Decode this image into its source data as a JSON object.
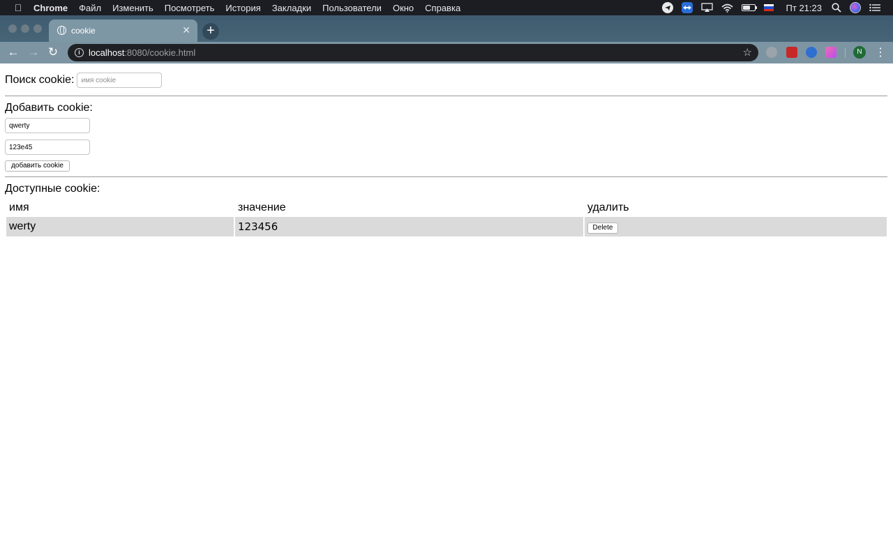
{
  "menubar": {
    "app": "Chrome",
    "items": [
      "Файл",
      "Изменить",
      "Посмотреть",
      "История",
      "Закладки",
      "Пользователи",
      "Окно",
      "Справка"
    ],
    "clock": "Пт 21:23",
    "icons": [
      "telegram-icon",
      "teamviewer-icon",
      "airplay-icon",
      "wifi-icon",
      "battery-icon",
      "russian-flag-icon",
      "search-icon",
      "siri-icon",
      "notification-center-icon"
    ]
  },
  "browser": {
    "tab_title": "cookie",
    "url_host": "localhost",
    "url_rest": ":8080/cookie.html",
    "profile_initial": "N",
    "colors": {
      "frame": "#476577",
      "toolbar": "#7d95a3",
      "omnibox": "#202124"
    }
  },
  "page": {
    "search_label": "Поиск cookie:",
    "search_placeholder": "имя cookie",
    "search_value": "",
    "add_heading": "Добавить cookie:",
    "add_name_value": "qwerty",
    "add_value_value": "123e45",
    "add_button": "добавить cookie",
    "available_heading": "Доступные cookie:",
    "table": {
      "headers": [
        "имя",
        "значение",
        "удалить"
      ],
      "rows": [
        {
          "name": "werty",
          "value": "123456",
          "delete_label": "Delete"
        }
      ]
    }
  }
}
